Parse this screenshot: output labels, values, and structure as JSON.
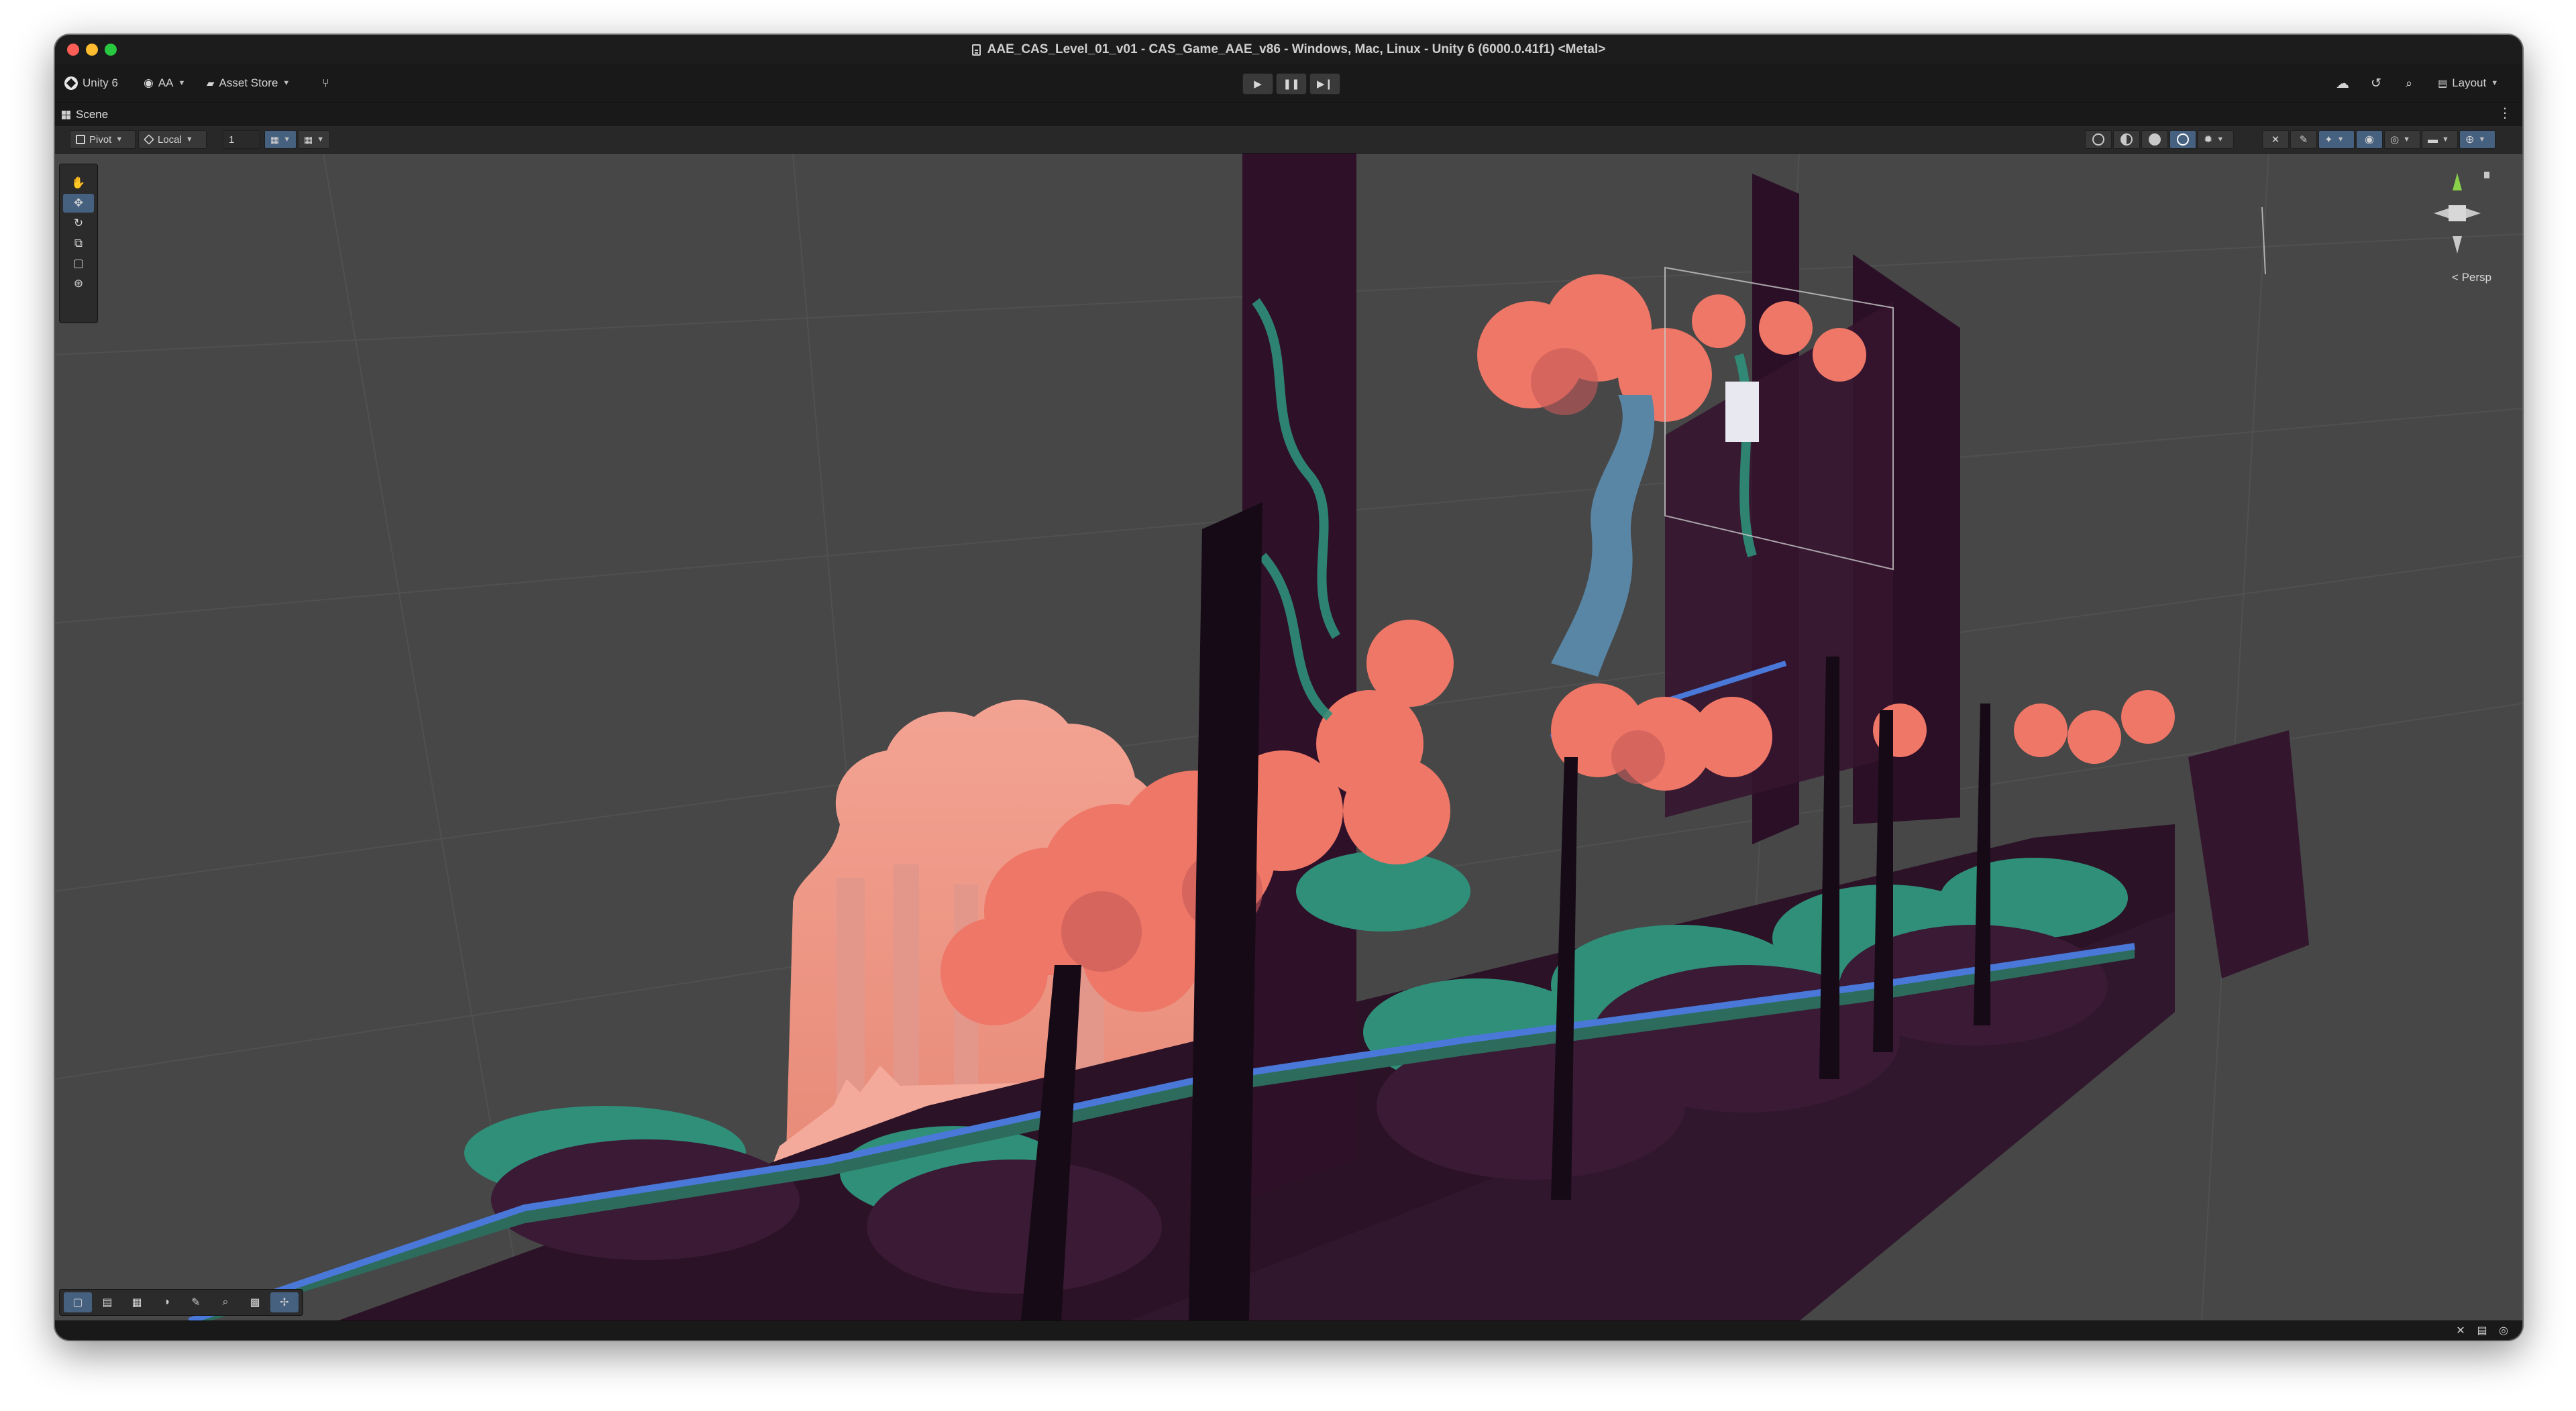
{
  "window": {
    "title": "AAE_CAS_Level_01_v01 - CAS_Game_AAE_v86 - Windows, Mac, Linux - Unity 6 (6000.0.41f1) <Metal>"
  },
  "toolbar": {
    "unity_label": "Unity 6",
    "account_label": "AA",
    "asset_store_label": "Asset Store",
    "layout_label": "Layout"
  },
  "scene_tab": {
    "label": "Scene"
  },
  "scene_toolbar": {
    "pivot_label": "Pivot",
    "local_label": "Local",
    "snap_value": "1"
  },
  "gizmo": {
    "projection_label": "Persp"
  },
  "colors": {
    "viewport_bg": "#474747",
    "accent": "#46607f",
    "foliage_coral": "#f07a6a",
    "foliage_teal": "#3aa087",
    "platform_blue": "#4a78d8",
    "level_plum": "#2b1226"
  }
}
